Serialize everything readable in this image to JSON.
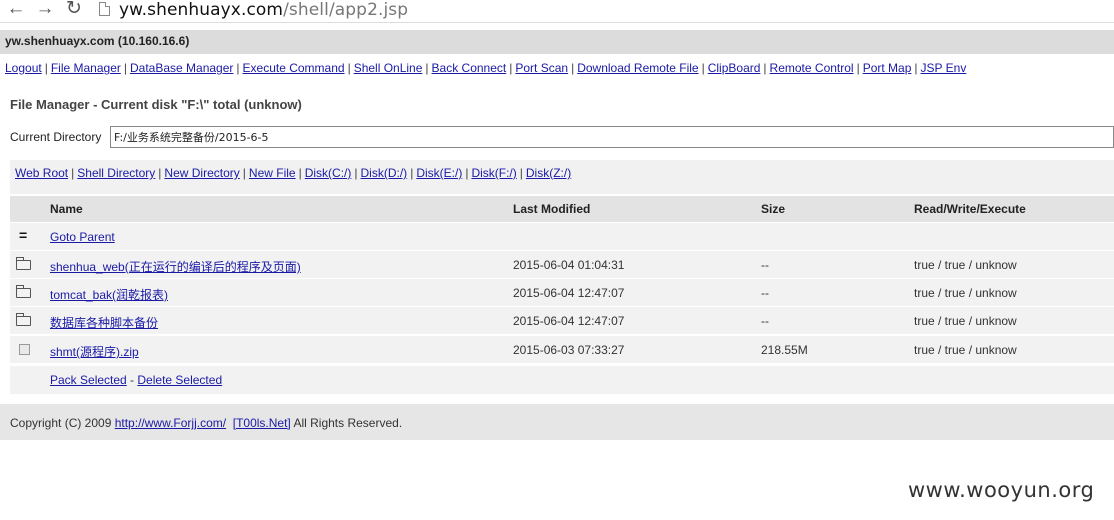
{
  "browser": {
    "url_host": "yw.shenhuayx.com",
    "url_path": "/shell/app2.jsp",
    "back_glyph": "←",
    "forward_glyph": "→",
    "reload_glyph": "↻"
  },
  "host_info": "yw.shenhuayx.com (10.160.16.6)",
  "menu": [
    "Logout",
    "File Manager",
    "DataBase Manager",
    "Execute Command",
    "Shell OnLine",
    "Back Connect",
    "Port Scan",
    "Download Remote File",
    "ClipBoard",
    "Remote Control",
    "Port Map",
    "JSP Env"
  ],
  "title": "File Manager - Current disk \"F:\\\" total (unknow)",
  "current_directory": {
    "label": "Current Directory",
    "value": "F:/业务系统完整备份/2015-6-5"
  },
  "quick_links": [
    "Web Root",
    "Shell Directory",
    "New Directory",
    "New File",
    "Disk(C:/)",
    "Disk(D:/)",
    "Disk(E:/)",
    "Disk(F:/)",
    "Disk(Z:/)"
  ],
  "table": {
    "headers": {
      "name": "Name",
      "modified": "Last Modified",
      "size": "Size",
      "rwx": "Read/Write/Execute"
    },
    "parent": {
      "icon": "=",
      "label": "Goto Parent"
    },
    "rows": [
      {
        "type": "folder-icon",
        "name": "shenhua_web(正在运行的编译后的程序及页面)",
        "modified": "2015-06-04 01:04:31",
        "size": "--",
        "rwx": "true / true / unknow"
      },
      {
        "type": "folder-icon",
        "name": "tomcat_bak(润乾报表)",
        "modified": "2015-06-04 12:47:07",
        "size": "--",
        "rwx": "true / true / unknow"
      },
      {
        "type": "folder-icon",
        "name": "数据库各种脚本备份",
        "modified": "2015-06-04 12:47:07",
        "size": "--",
        "rwx": "true / true / unknow"
      },
      {
        "type": "checkbox",
        "name": "shmt(源程序).zip",
        "modified": "2015-06-03 07:33:27",
        "size": "218.55M",
        "rwx": "true / true / unknow"
      }
    ]
  },
  "actions": {
    "pack": "Pack Selected",
    "separator": " - ",
    "delete": "Delete Selected"
  },
  "footer": {
    "prefix": "Copyright (C) 2009 ",
    "link1": "http://www.Forjj.com/",
    "link2": "[T00ls.Net]",
    "suffix": " All Rights Reserved."
  },
  "watermark": "www.wooyun.org"
}
